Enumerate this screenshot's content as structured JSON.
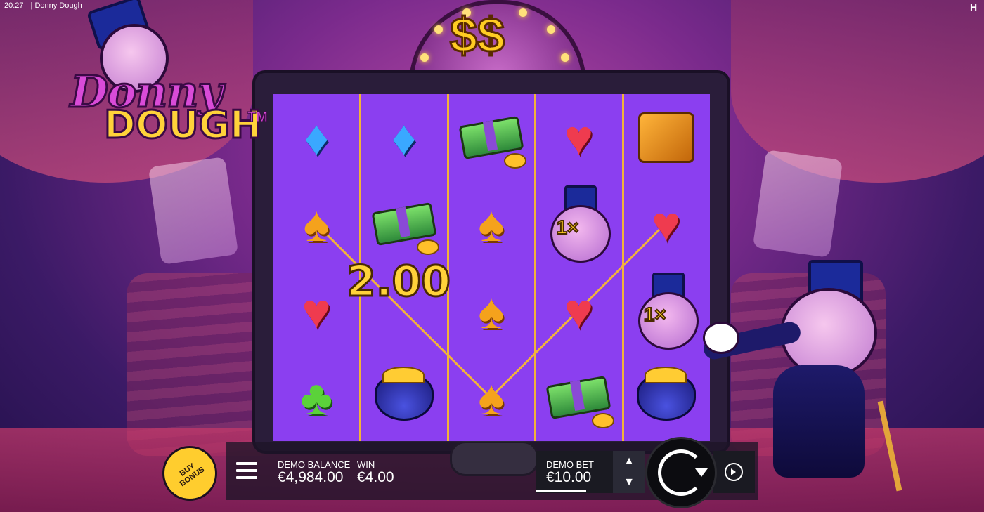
{
  "status_bar": {
    "time": "20:27",
    "title": "| Donny Dough"
  },
  "logo": {
    "line1": "Donny",
    "line2": "DOUGH",
    "trademark": "TM"
  },
  "marquee": {
    "symbols": "$$"
  },
  "reels": [
    [
      "diamond",
      "spade",
      "heart",
      "club"
    ],
    [
      "diamond",
      "cash",
      "win",
      "purse"
    ],
    [
      "cash",
      "spade",
      "spade",
      "spade"
    ],
    [
      "heart",
      "donny",
      "heart",
      "cash"
    ],
    [
      "safe",
      "heart",
      "donny",
      "purse"
    ]
  ],
  "donny_multipliers": [
    "1×",
    "1×"
  ],
  "win_display": "2.00",
  "bottom_bar": {
    "buy_bonus": "BUY BONUS",
    "balance_label": "DEMO BALANCE",
    "balance_value": "€4,984.00",
    "win_label": "WIN",
    "win_value": "€4.00",
    "bet_label": "DEMO BET",
    "bet_value": "€10.00"
  },
  "icons": [
    "menu-icon",
    "bet-up-icon",
    "bet-down-icon",
    "spin-icon",
    "autoplay-icon"
  ],
  "colors": {
    "reel_bg": "#8b3ff0",
    "reel_divider": "#f2b33a",
    "win_text": "#ffd23a",
    "buy_bonus": "#ffcd2e"
  }
}
